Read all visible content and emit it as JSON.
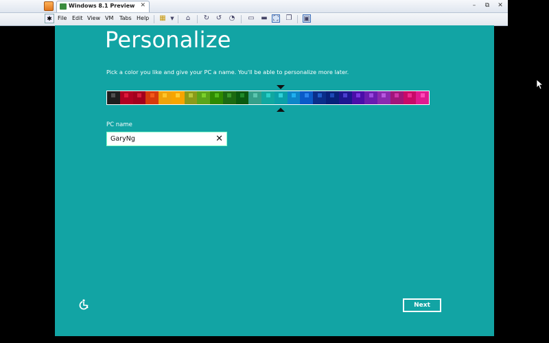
{
  "tabbar": {
    "tab_title": "Windows 8.1 Preview",
    "tab_close": "✕",
    "minimize": "–",
    "restore": "⧉",
    "close": "✕"
  },
  "toolbar": {
    "menus": [
      "File",
      "Edit",
      "View",
      "VM",
      "Tabs",
      "Help"
    ]
  },
  "setup": {
    "title": "Personalize",
    "instruction": "Pick a color you like and give your PC a name. You'll be able to personalize more later.",
    "pc_name_label": "PC name",
    "pc_name_value": "GaryNg",
    "clear_glyph": "✕",
    "next_label": "Next",
    "selected_color_index": 13,
    "colors": [
      {
        "bg": "#1e1e1e",
        "accent": "#505050"
      },
      {
        "bg": "#b00022",
        "accent": "#e0183a"
      },
      {
        "bg": "#a3001d",
        "accent": "#d81c3a"
      },
      {
        "bg": "#d63a0c",
        "accent": "#f35a1a"
      },
      {
        "bg": "#f0a30a",
        "accent": "#ffc52a"
      },
      {
        "bg": "#f7a500",
        "accent": "#ffcc33"
      },
      {
        "bg": "#8b9b1a",
        "accent": "#b6c63a"
      },
      {
        "bg": "#5aa51a",
        "accent": "#7bd02a"
      },
      {
        "bg": "#2e8a00",
        "accent": "#52b91a"
      },
      {
        "bg": "#1c6a12",
        "accent": "#3a9a2a"
      },
      {
        "bg": "#0a5a10",
        "accent": "#1f8a2a"
      },
      {
        "bg": "#35a08a",
        "accent": "#5cc6b0"
      },
      {
        "bg": "#10a8a0",
        "accent": "#2ad0c8"
      },
      {
        "bg": "#0aa0a8",
        "accent": "#2fd0d8"
      },
      {
        "bg": "#0d86c8",
        "accent": "#1fb0f0"
      },
      {
        "bg": "#0a5ac8",
        "accent": "#2a84ee"
      },
      {
        "bg": "#0a2f8a",
        "accent": "#1f5cc8"
      },
      {
        "bg": "#07227a",
        "accent": "#1c48b8"
      },
      {
        "bg": "#1e1690",
        "accent": "#4a3ed0"
      },
      {
        "bg": "#4a0ea8",
        "accent": "#7a34e0"
      },
      {
        "bg": "#6a1cb0",
        "accent": "#9a4ae0"
      },
      {
        "bg": "#8a2ab0",
        "accent": "#b75ae0"
      },
      {
        "bg": "#a0157a",
        "accent": "#d034a8"
      },
      {
        "bg": "#c80a68",
        "accent": "#ee2a90"
      },
      {
        "bg": "#e01a90",
        "accent": "#ff4ab8"
      }
    ]
  },
  "colors": {
    "guest_background": "#12a4a4",
    "host_background": "#000000"
  }
}
